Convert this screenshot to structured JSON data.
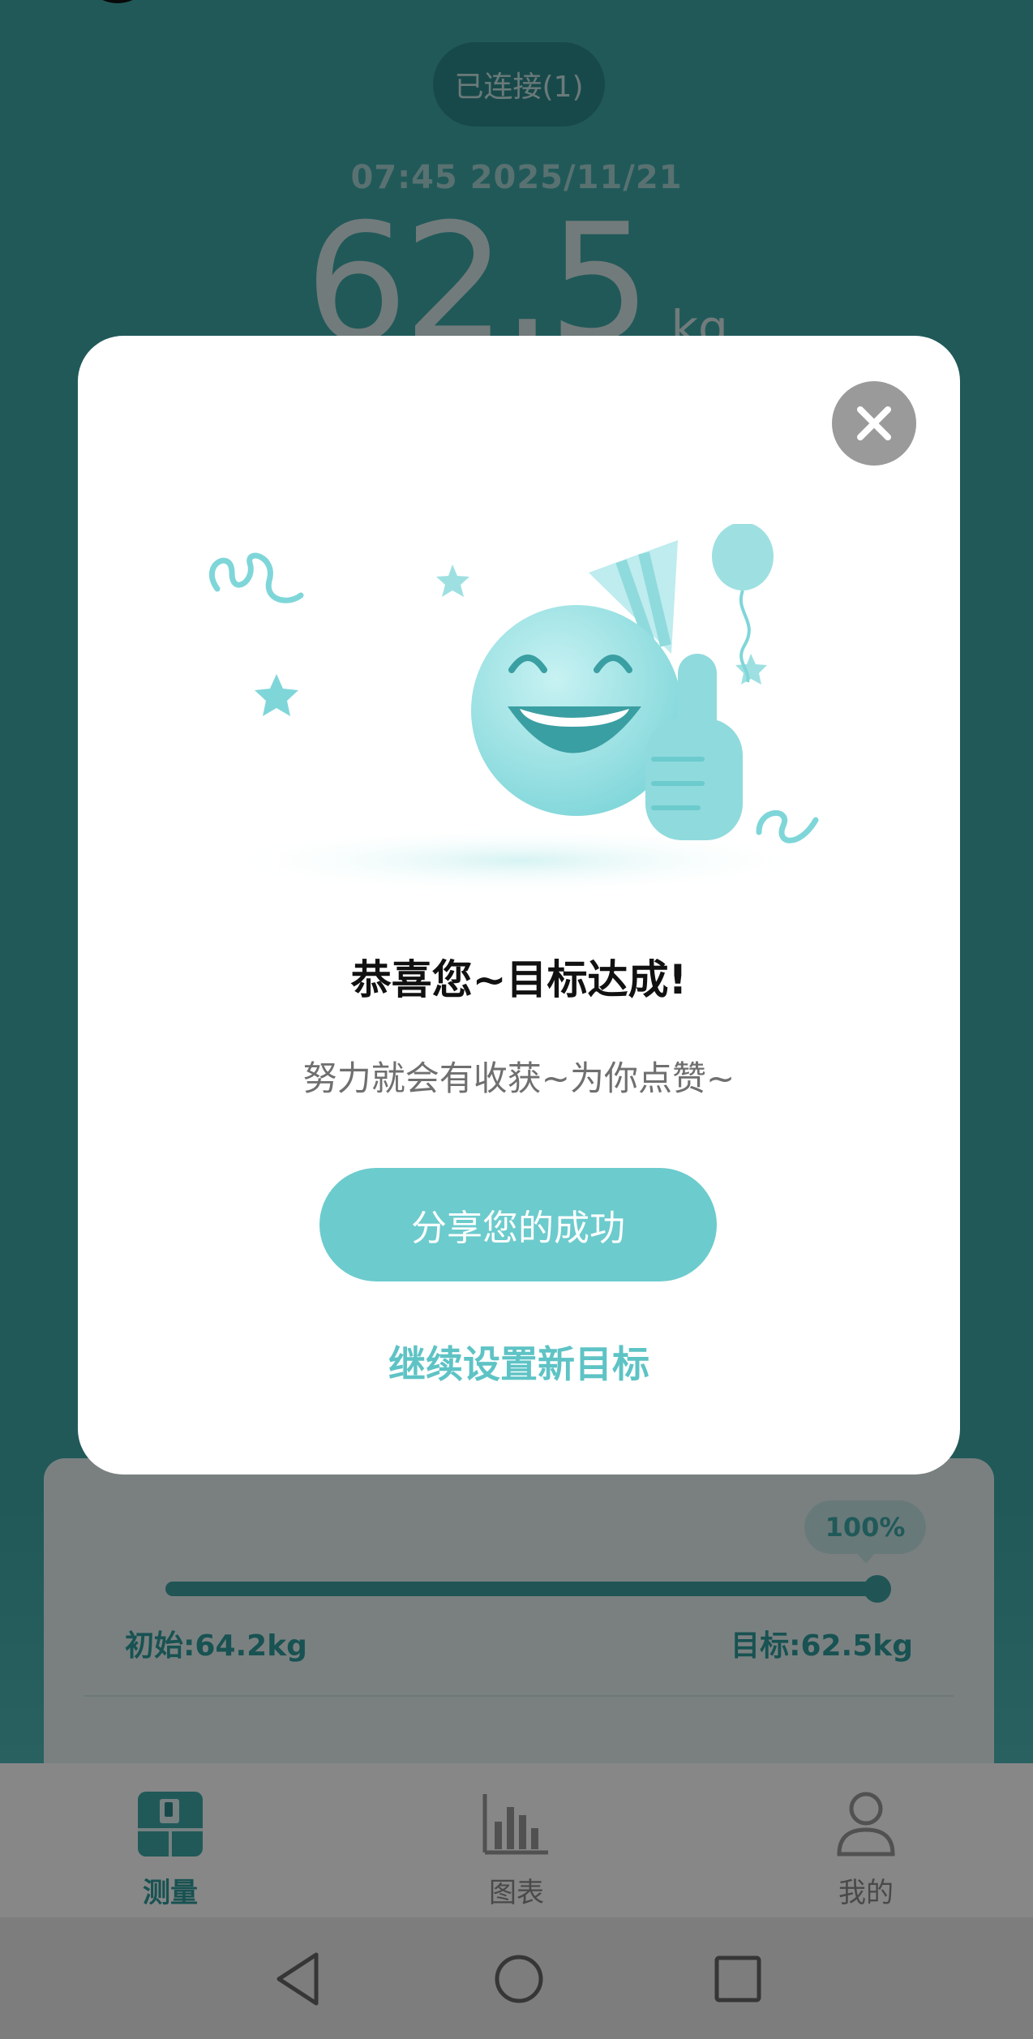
{
  "app": {
    "connection_status": "已连接(1)",
    "measure_datetime": "07:45 2025/11/21",
    "weight_value": "62.5",
    "weight_unit": "kg"
  },
  "progress": {
    "percent_label": "100%",
    "percent": 100,
    "start_label": "初始:64.2kg",
    "goal_label": "目标:62.5kg"
  },
  "tabs": [
    {
      "label": "测量",
      "icon": "scale-icon",
      "active": true
    },
    {
      "label": "图表",
      "icon": "bar-chart-icon",
      "active": false
    },
    {
      "label": "我的",
      "icon": "user-icon",
      "active": false
    }
  ],
  "system_nav": {
    "back": "back-icon",
    "home": "home-icon",
    "recents": "recents-icon"
  },
  "dialog": {
    "title": "恭喜您~目标达成!",
    "subtitle": "努力就会有收获~为你点赞~",
    "share_label": "分享您的成功",
    "continue_label": "继续设置新目标",
    "close_icon": "close-icon",
    "illustration": "celebration-emoji-illustration"
  },
  "colors": {
    "accent": "#6ccbcd",
    "app_background": "#3fa9a9",
    "close_button": "#9a9a9a"
  }
}
